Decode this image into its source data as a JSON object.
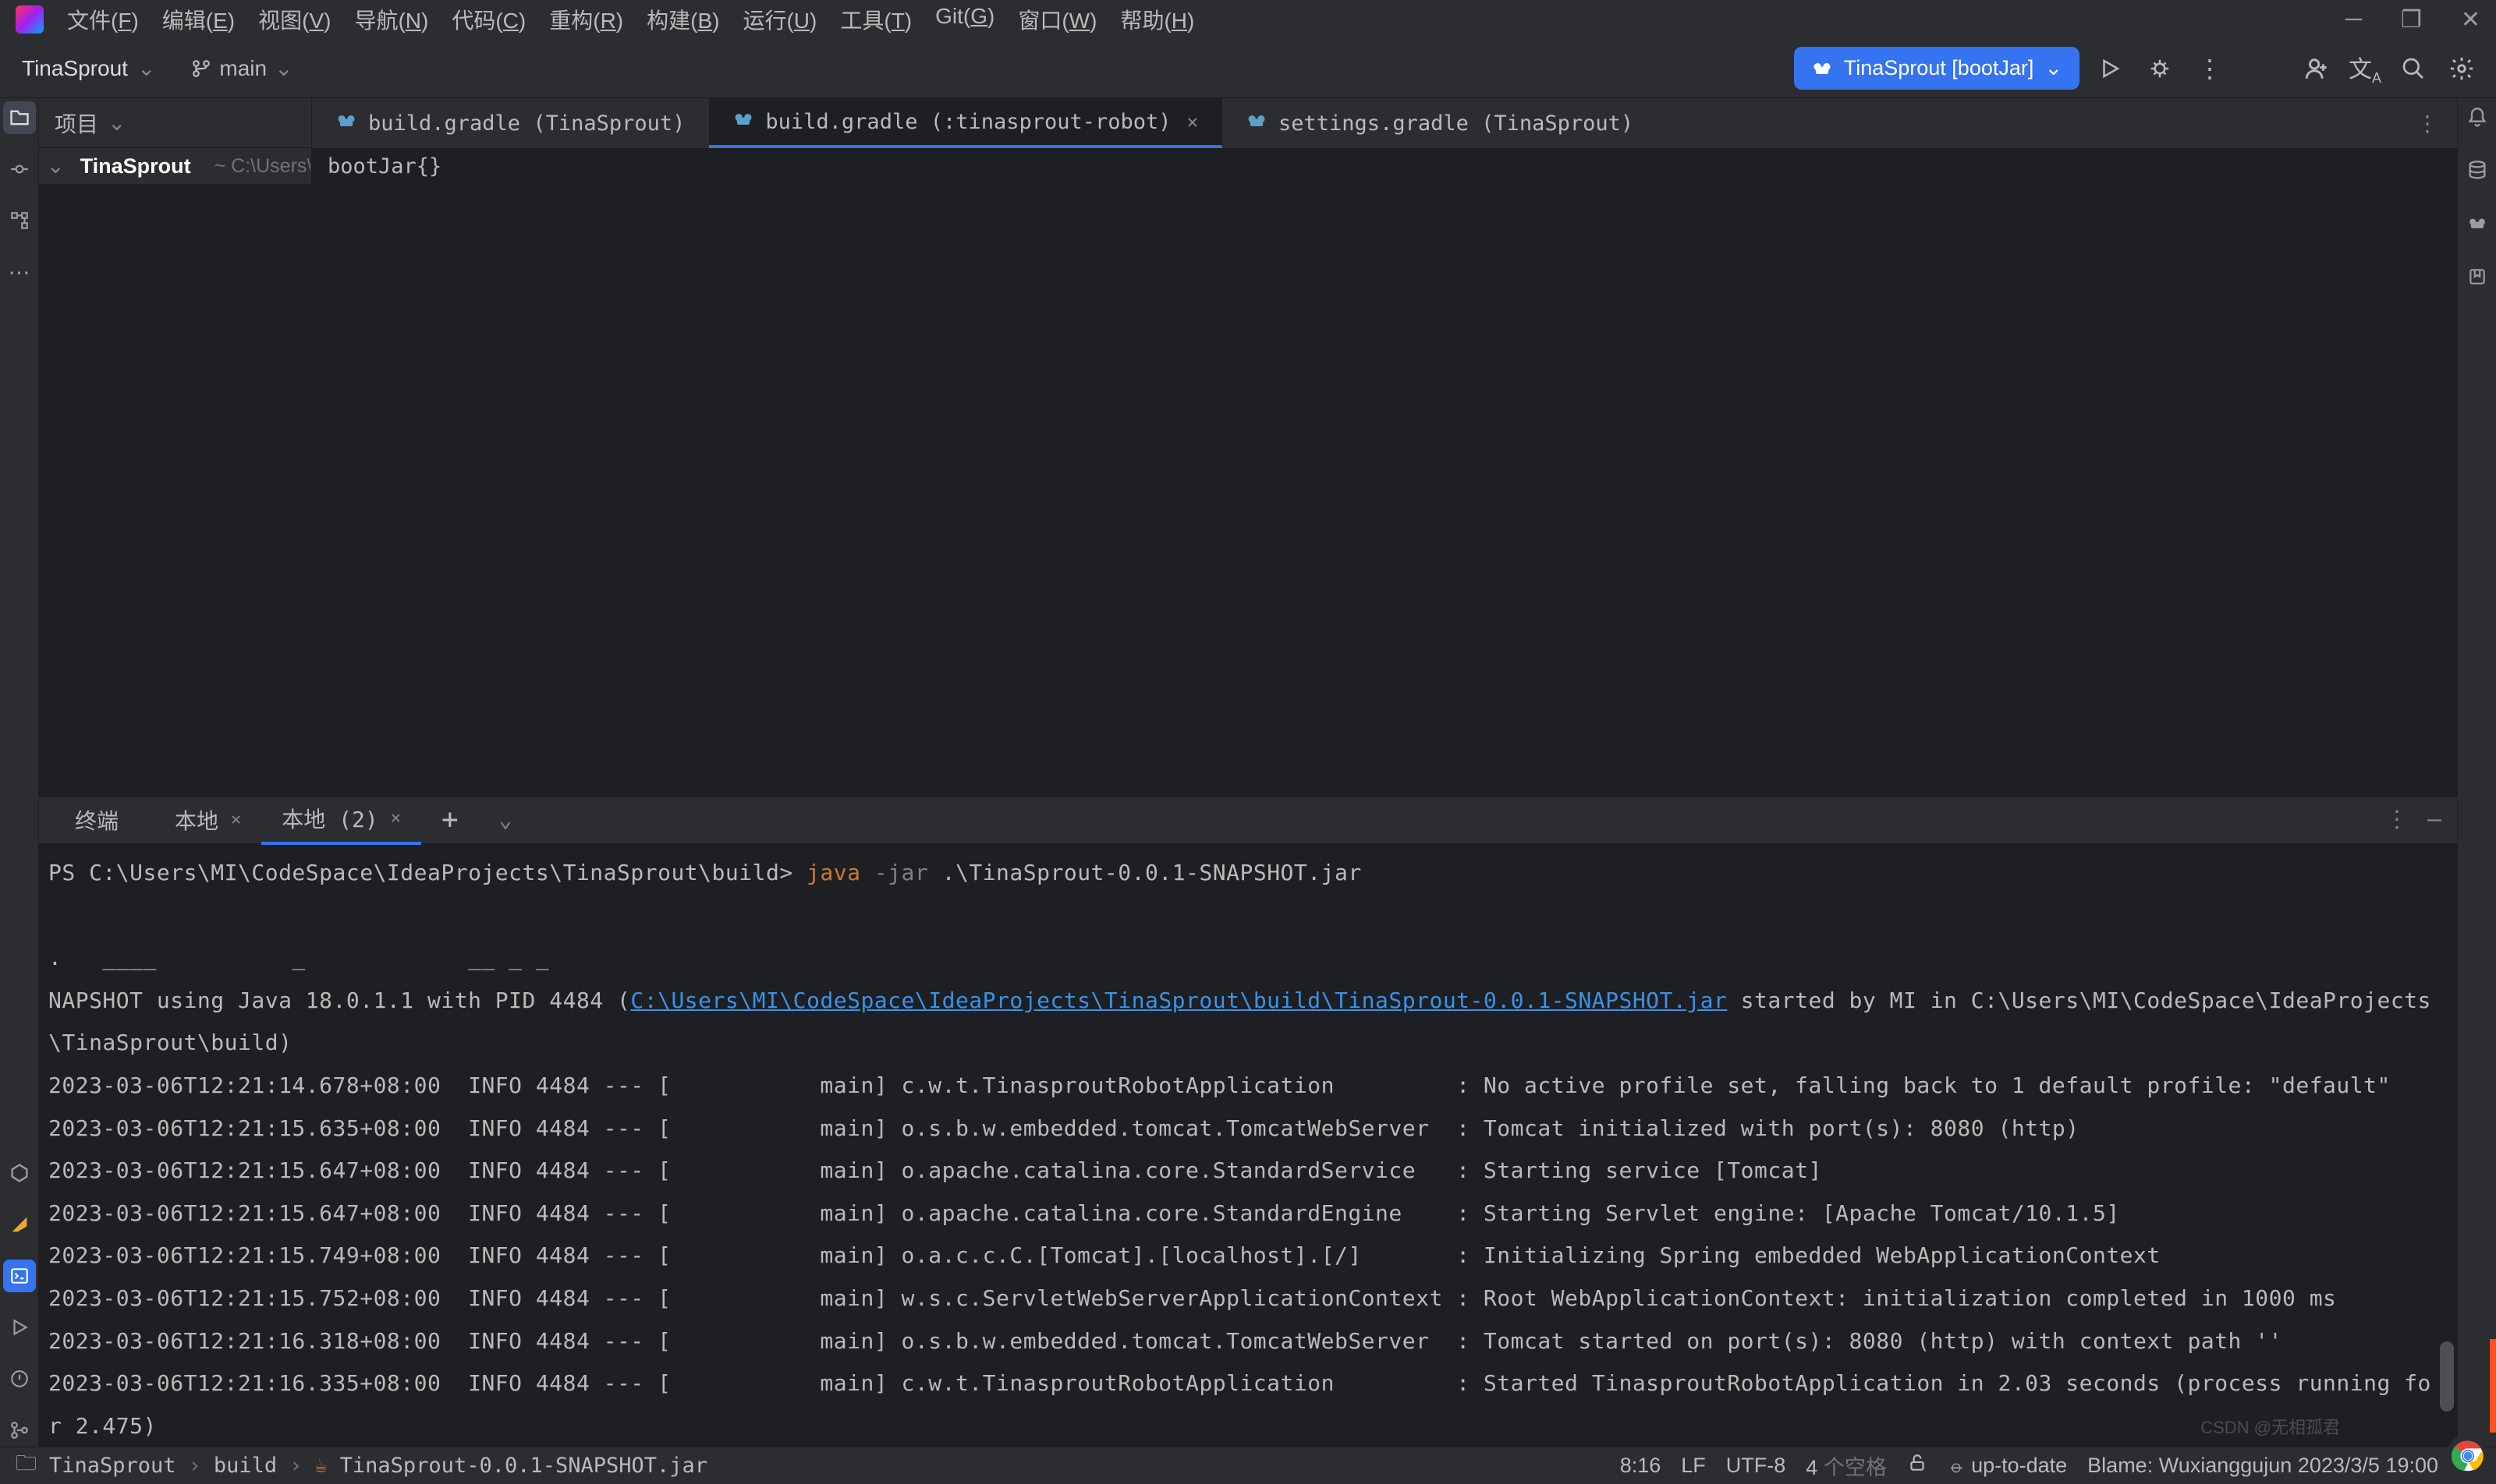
{
  "menu": {
    "file": "文件(F)",
    "edit": "编辑(E)",
    "view": "视图(V)",
    "nav": "导航(N)",
    "code": "代码(C)",
    "refactor": "重构(R)",
    "build": "构建(B)",
    "run": "运行(U)",
    "tools": "工具(T)",
    "git": "Git(G)",
    "window": "窗口(W)",
    "help": "帮助(H)"
  },
  "nav": {
    "project": "TinaSprout",
    "branch": "main",
    "runConfig": "TinaSprout [bootJar]"
  },
  "project_panel": {
    "title": "项目",
    "root": "TinaSprout",
    "root_path": "~  C:\\Users\\MI\\CodeSpace"
  },
  "editor_tabs": [
    {
      "label": "build.gradle (TinaSprout)",
      "active": false,
      "closeable": false
    },
    {
      "label": "build.gradle (:tinasprout-robot)",
      "active": true,
      "closeable": true
    },
    {
      "label": "settings.gradle (TinaSprout)",
      "active": false,
      "closeable": false
    }
  ],
  "editor_crumb": "bootJar{}",
  "terminal": {
    "title": "终端",
    "tabs": [
      {
        "label": "本地",
        "close": true,
        "sel": false
      },
      {
        "label": "本地 (2)",
        "close": true,
        "sel": true
      }
    ],
    "prompt": "PS C:\\Users\\MI\\CodeSpace\\IdeaProjects\\TinaSprout\\build>",
    "cmd_java": "java",
    "cmd_flag": "-jar",
    "cmd_arg": ".\\TinaSprout-0.0.1-SNAPSHOT.jar",
    "line_snap_a": "NAPSHOT using Java 18.0.1.1 with PID 4484 (",
    "line_snap_link": "C:\\Users\\MI\\CodeSpace\\IdeaProjects\\TinaSprout\\build\\TinaSprout-0.0.1-SNAPSHOT.jar",
    "line_snap_b": " started by MI in C:\\Users\\MI\\CodeSpace\\IdeaProjects\\TinaSprout\\build)",
    "lines": [
      "2023-03-06T12:21:14.678+08:00  INFO 4484 --- [           main] c.w.t.TinasproutRobotApplication         : No active profile set, falling back to 1 default profile: \"default\"",
      "2023-03-06T12:21:15.635+08:00  INFO 4484 --- [           main] o.s.b.w.embedded.tomcat.TomcatWebServer  : Tomcat initialized with port(s): 8080 (http)",
      "2023-03-06T12:21:15.647+08:00  INFO 4484 --- [           main] o.apache.catalina.core.StandardService   : Starting service [Tomcat]",
      "2023-03-06T12:21:15.647+08:00  INFO 4484 --- [           main] o.apache.catalina.core.StandardEngine    : Starting Servlet engine: [Apache Tomcat/10.1.5]",
      "2023-03-06T12:21:15.749+08:00  INFO 4484 --- [           main] o.a.c.c.C.[Tomcat].[localhost].[/]       : Initializing Spring embedded WebApplicationContext",
      "2023-03-06T12:21:15.752+08:00  INFO 4484 --- [           main] w.s.c.ServletWebServerApplicationContext : Root WebApplicationContext: initialization completed in 1000 ms",
      "2023-03-06T12:21:16.318+08:00  INFO 4484 --- [           main] o.s.b.w.embedded.tomcat.TomcatWebServer  : Tomcat started on port(s): 8080 (http) with context path ''",
      "2023-03-06T12:21:16.335+08:00  INFO 4484 --- [           main] c.w.t.TinasproutRobotApplication         : Started TinasproutRobotApplication in 2.03 seconds (process running for 2.475)"
    ],
    "banner_frag": ".   ____          _            __ _ _"
  },
  "status": {
    "crumb1": "TinaSprout",
    "crumb2": "build",
    "crumb3": "TinaSprout-0.0.1-SNAPSHOT.jar",
    "position": "8:16",
    "lineend": "LF",
    "encoding": "UTF-8",
    "indent": "4",
    "indent_label": "个空格",
    "blame": "Blame: Wuxianggujun 2023/3/5 19:00",
    "update": "up-to-date"
  },
  "watermark": "CSDN @无相孤君"
}
